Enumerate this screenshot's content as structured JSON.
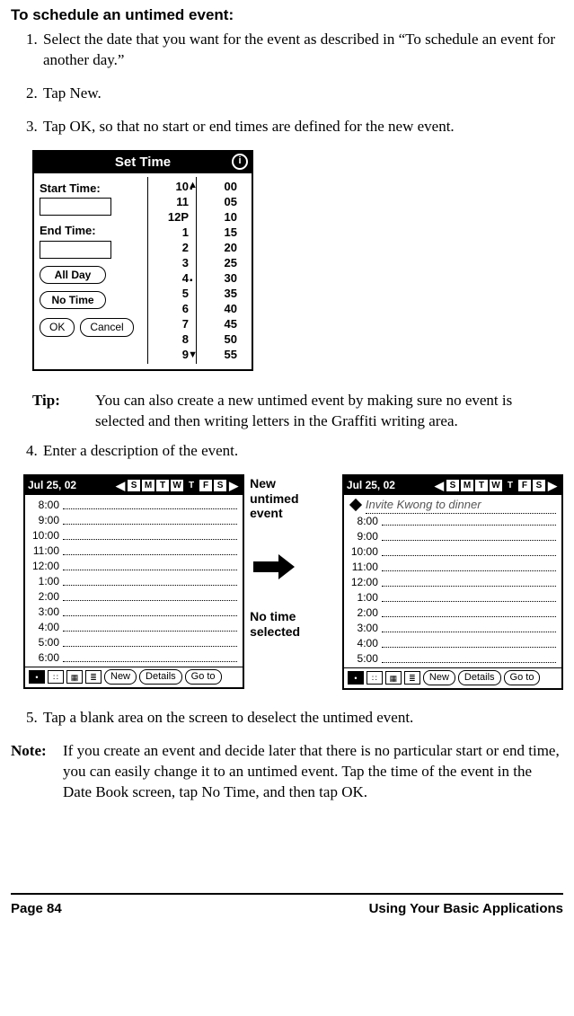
{
  "heading": "To schedule an untimed event:",
  "steps": {
    "s1": "Select the date that you want for the event as described in “To schedule an event for another day.”",
    "s2": "Tap New.",
    "s3": "Tap OK, so that no start or end times are defined for the new event.",
    "s4": "Enter a description of the event.",
    "s5": "Tap a blank area on the screen to deselect the untimed event."
  },
  "set_time": {
    "title": "Set Time",
    "start_label": "Start Time:",
    "end_label": "End Time:",
    "all_day": "All Day",
    "no_time": "No Time",
    "ok": "OK",
    "cancel": "Cancel",
    "hours": [
      "10",
      "11",
      "12P",
      "1",
      "2",
      "3",
      "4",
      "5",
      "6",
      "7",
      "8",
      "9"
    ],
    "mins": [
      "00",
      "05",
      "10",
      "15",
      "20",
      "25",
      "30",
      "35",
      "40",
      "45",
      "50",
      "55"
    ]
  },
  "tip": {
    "label": "Tip:",
    "body": "You can also create a new untimed event by making sure no event is selected and then writing letters in the Graffiti writing area."
  },
  "mid": {
    "label_top_l1": "New",
    "label_top_l2": "untimed",
    "label_top_l3": "event",
    "label_bot_l1": "No time",
    "label_bot_l2": "selected"
  },
  "cal": {
    "date": "Jul 25, 02",
    "days": [
      "S",
      "M",
      "T",
      "W",
      "T",
      "F",
      "S"
    ],
    "timesA": [
      "8:00",
      "9:00",
      "10:00",
      "11:00",
      "12:00",
      "1:00",
      "2:00",
      "3:00",
      "4:00",
      "5:00",
      "6:00"
    ],
    "timesB": [
      "8:00",
      "9:00",
      "10:00",
      "11:00",
      "12:00",
      "1:00",
      "2:00",
      "3:00",
      "4:00",
      "5:00"
    ],
    "untimed_text": "Invite Kwong to dinner",
    "btn_new": "New",
    "btn_details": "Details",
    "btn_goto": "Go to"
  },
  "note": {
    "label": "Note:",
    "body": "If you create an event and decide later that there is no particular start or end time, you can easily change it to an untimed event. Tap the time of the event in the Date Book screen, tap No Time, and then tap OK."
  },
  "footer": {
    "left": "Page 84",
    "right": "Using Your Basic Applications"
  }
}
